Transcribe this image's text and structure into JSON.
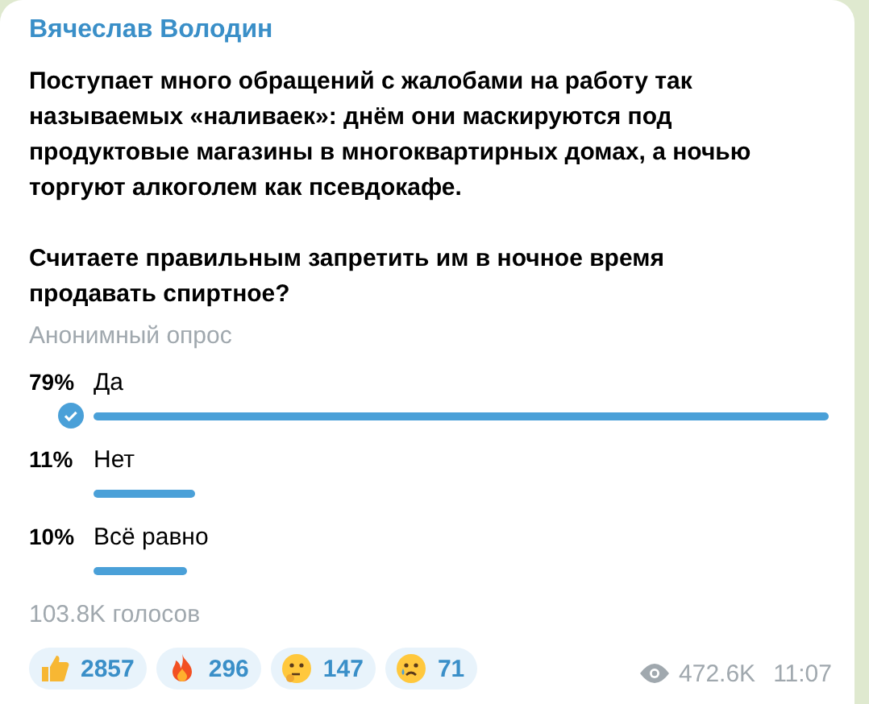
{
  "message": {
    "author": "Вячеслав Володин",
    "paragraphs": [
      "Поступает много обращений с жалобами на работу так называемых «наливаек»: днём они маскируются под продуктовые магазины в многоквартирных домах, а ночью торгуют алкоголем как псевдокафе.",
      "Считаете правильным запретить им в ночное время продавать спиртное?"
    ]
  },
  "poll": {
    "type": "Анонимный опрос",
    "options": [
      {
        "percent": "79%",
        "label": "Да",
        "selected": true
      },
      {
        "percent": "11%",
        "label": "Нет",
        "selected": false
      },
      {
        "percent": "10%",
        "label": "Всё равно",
        "selected": false
      }
    ],
    "votes": "103.8K голосов"
  },
  "reactions": [
    {
      "kind": "thumbs-up",
      "count": "2857"
    },
    {
      "kind": "fire",
      "count": "296"
    },
    {
      "kind": "thinking",
      "count": "147"
    },
    {
      "kind": "crying",
      "count": "71"
    }
  ],
  "views": "472.6K",
  "time": "11:07"
}
